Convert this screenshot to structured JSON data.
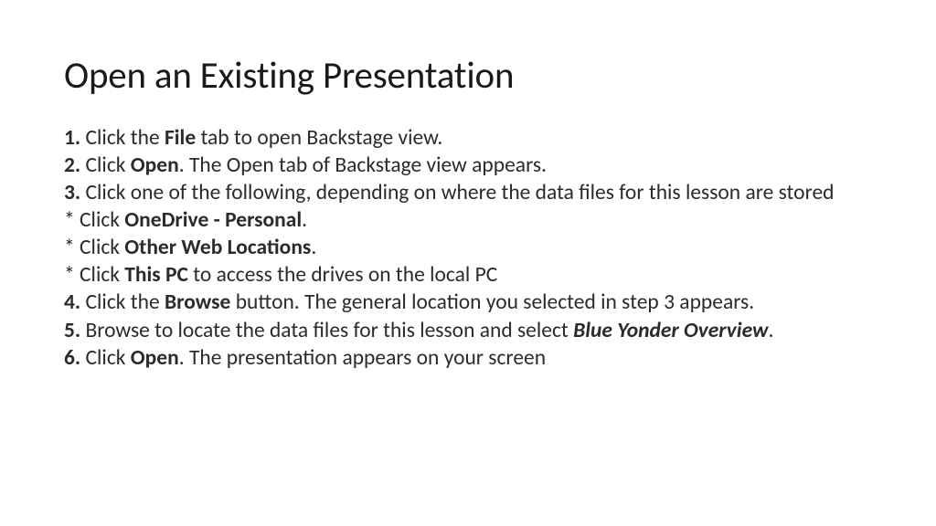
{
  "title": "Open an Existing Presentation",
  "s1_num": "1.",
  "s1_pre": " Click the ",
  "s1_bold": "File",
  "s1_post": " tab to open Backstage view.",
  "s2_num": "2.",
  "s2_pre": " Click ",
  "s2_bold": "Open",
  "s2_post": ". The Open tab of Backstage view appears.",
  "s3_num": "3.",
  "s3_post": " Click one of the following, depending on where the data files for this lesson are stored",
  "b1_pre": "* Click ",
  "b1_bold": "OneDrive - Personal",
  "b1_post": ".",
  "b2_pre": "* Click ",
  "b2_bold": "Other Web Locations",
  "b2_post": ".",
  "b3_pre": "* Click ",
  "b3_bold": "This PC",
  "b3_post": " to access the drives on the local PC",
  "s4_num": "4.",
  "s4_pre": " Click the ",
  "s4_bold": "Browse",
  "s4_post": " button. The general location you selected in step 3 appears.",
  "s5_num": "5.",
  "s5_pre": " Browse to locate the data files for this lesson and select ",
  "s5_bi": "Blue Yonder Overview",
  "s5_post": ".",
  "s6_num": "6.",
  "s6_pre": " Click ",
  "s6_bold": "Open",
  "s6_post": ". The presentation appears on your screen"
}
